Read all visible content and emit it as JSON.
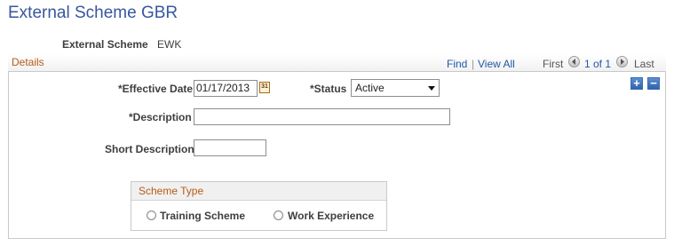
{
  "page": {
    "title": "External Scheme GBR"
  },
  "header": {
    "scheme_label": "External Scheme",
    "scheme_value": "EWK"
  },
  "details": {
    "title": "Details",
    "nav": {
      "find": "Find",
      "separator": "|",
      "view_all": "View All",
      "first": "First",
      "count": "1 of 1",
      "last": "Last"
    }
  },
  "form": {
    "effective_date_label": "*Effective Date",
    "effective_date_value": "01/17/2013",
    "calendar_icon_text": "31",
    "status_label": "*Status",
    "status_value": "Active",
    "description_label": "*Description",
    "description_value": "",
    "short_description_label": "Short Description",
    "short_description_value": ""
  },
  "row_buttons": {
    "add": "+",
    "remove": "−"
  },
  "scheme_type": {
    "title": "Scheme Type",
    "options": [
      "Training Scheme",
      "Work Experience"
    ]
  },
  "colors": {
    "title": "#37579e",
    "section": "#b75b16",
    "link": "#1f58a8"
  },
  "icons": [
    "calendar-icon",
    "previous-arrow-icon",
    "next-arrow-icon",
    "add-row-icon",
    "delete-row-icon"
  ]
}
